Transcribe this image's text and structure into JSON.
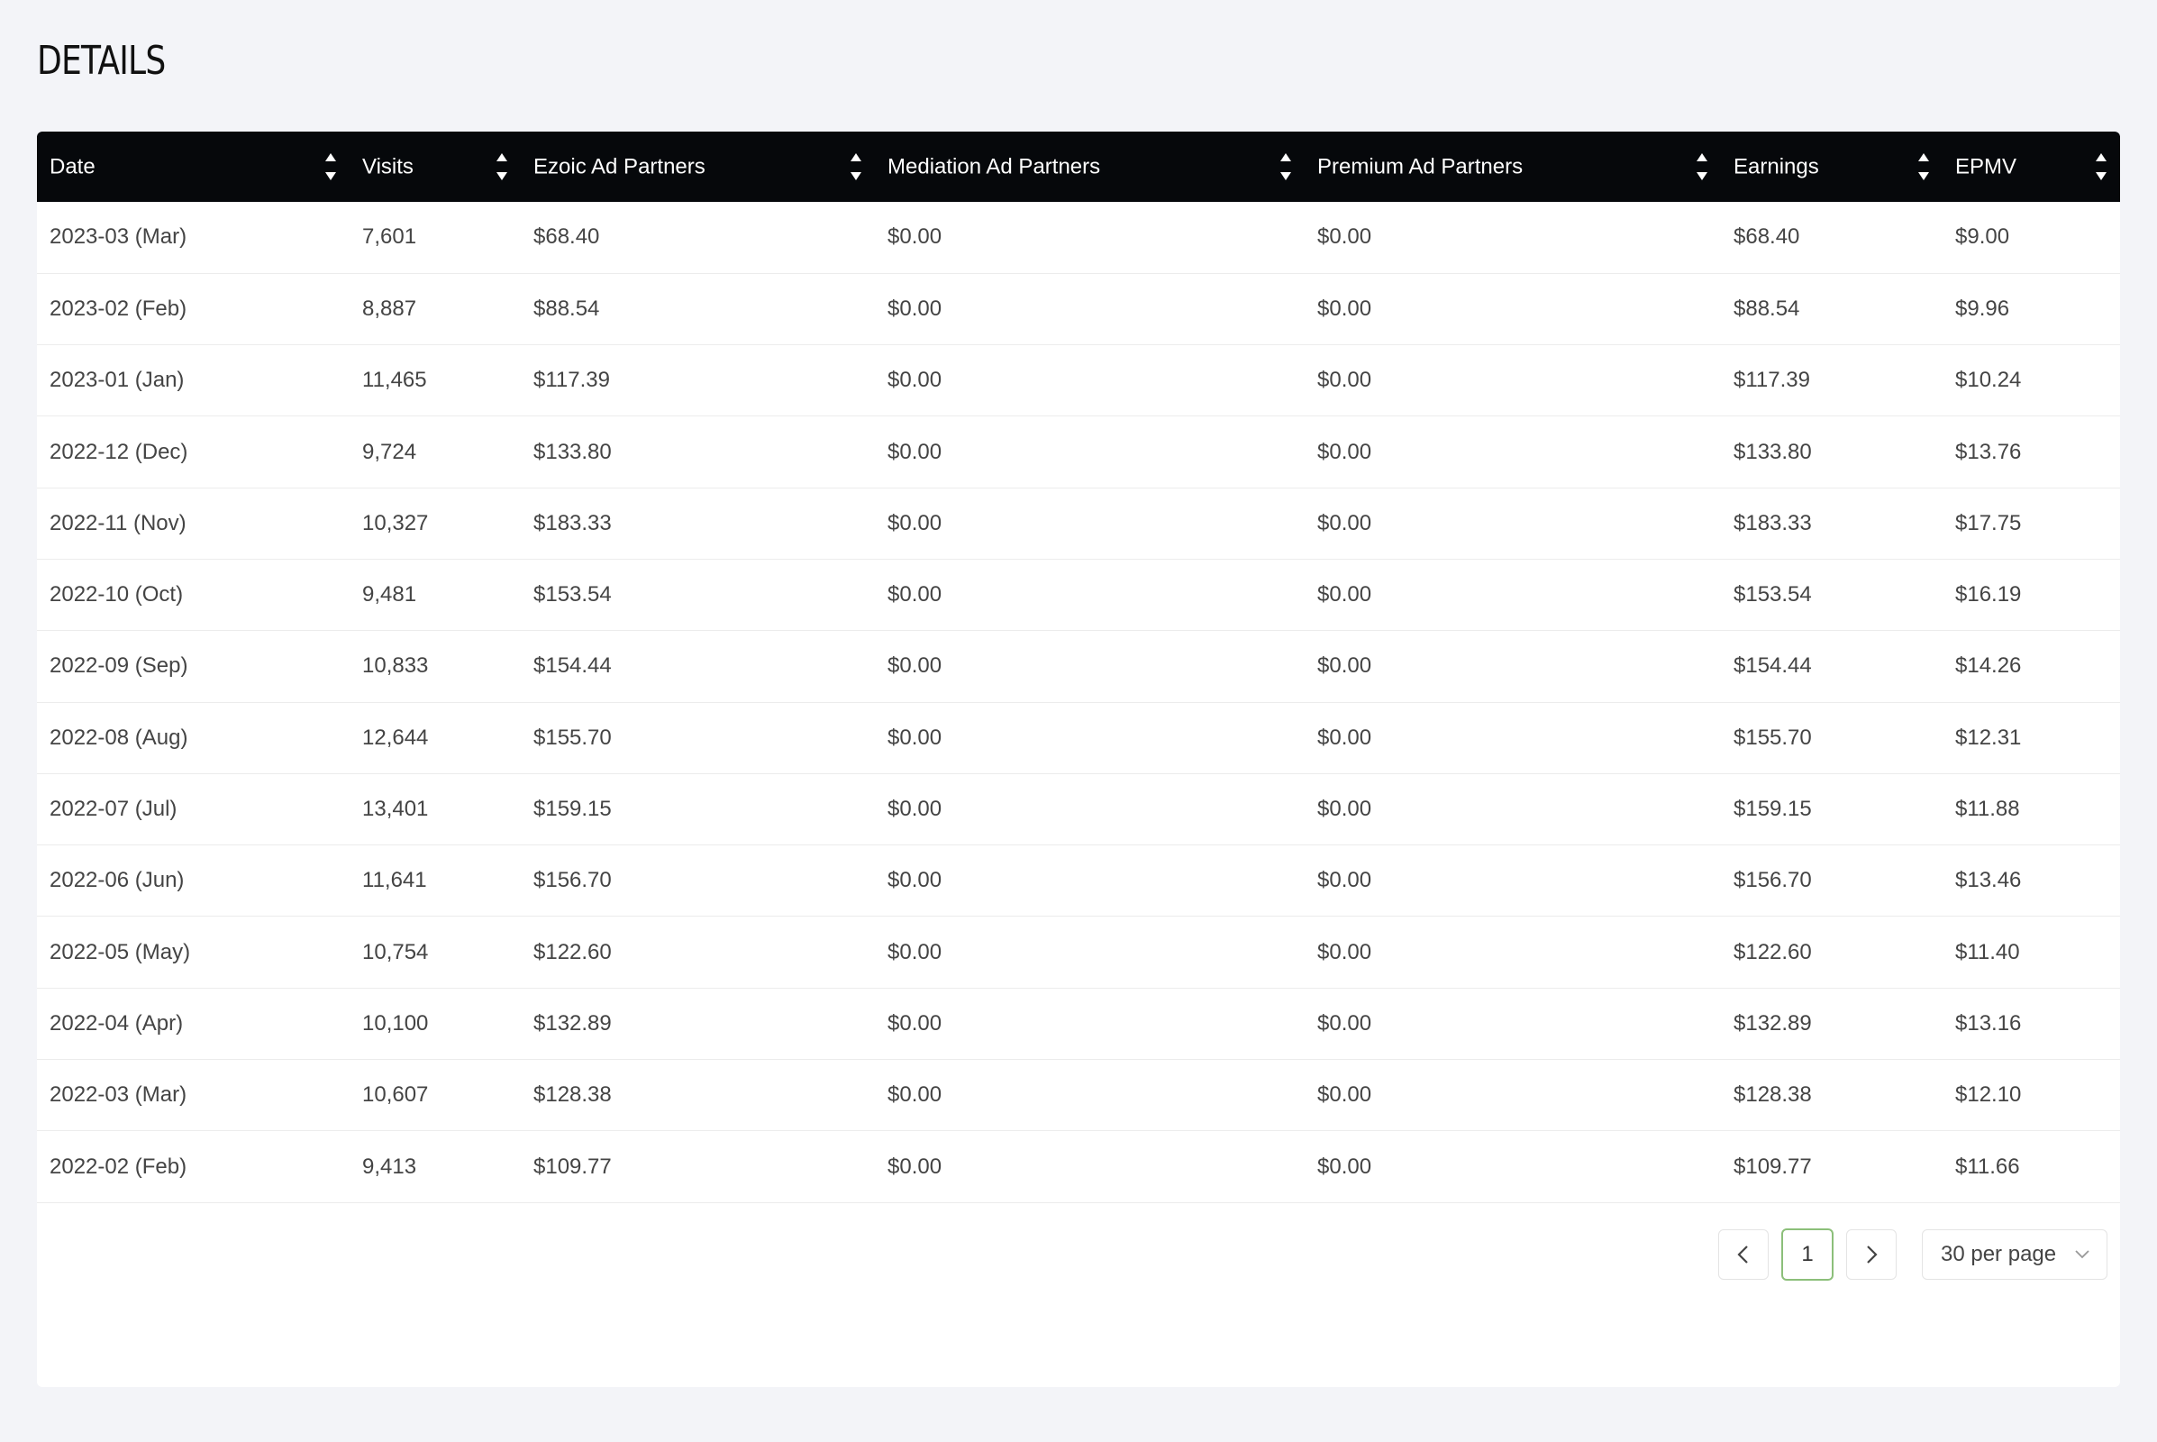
{
  "page": {
    "title": "DETAILS"
  },
  "table": {
    "columns": [
      "Date",
      "Visits",
      "Ezoic Ad Partners",
      "Mediation Ad Partners",
      "Premium Ad Partners",
      "Earnings",
      "EPMV"
    ],
    "rows": [
      [
        "2023-03 (Mar)",
        "7,601",
        "$68.40",
        "$0.00",
        "$0.00",
        "$68.40",
        "$9.00"
      ],
      [
        "2023-02 (Feb)",
        "8,887",
        "$88.54",
        "$0.00",
        "$0.00",
        "$88.54",
        "$9.96"
      ],
      [
        "2023-01 (Jan)",
        "11,465",
        "$117.39",
        "$0.00",
        "$0.00",
        "$117.39",
        "$10.24"
      ],
      [
        "2022-12 (Dec)",
        "9,724",
        "$133.80",
        "$0.00",
        "$0.00",
        "$133.80",
        "$13.76"
      ],
      [
        "2022-11 (Nov)",
        "10,327",
        "$183.33",
        "$0.00",
        "$0.00",
        "$183.33",
        "$17.75"
      ],
      [
        "2022-10 (Oct)",
        "9,481",
        "$153.54",
        "$0.00",
        "$0.00",
        "$153.54",
        "$16.19"
      ],
      [
        "2022-09 (Sep)",
        "10,833",
        "$154.44",
        "$0.00",
        "$0.00",
        "$154.44",
        "$14.26"
      ],
      [
        "2022-08 (Aug)",
        "12,644",
        "$155.70",
        "$0.00",
        "$0.00",
        "$155.70",
        "$12.31"
      ],
      [
        "2022-07 (Jul)",
        "13,401",
        "$159.15",
        "$0.00",
        "$0.00",
        "$159.15",
        "$11.88"
      ],
      [
        "2022-06 (Jun)",
        "11,641",
        "$156.70",
        "$0.00",
        "$0.00",
        "$156.70",
        "$13.46"
      ],
      [
        "2022-05 (May)",
        "10,754",
        "$122.60",
        "$0.00",
        "$0.00",
        "$122.60",
        "$11.40"
      ],
      [
        "2022-04 (Apr)",
        "10,100",
        "$132.89",
        "$0.00",
        "$0.00",
        "$132.89",
        "$13.16"
      ],
      [
        "2022-03 (Mar)",
        "10,607",
        "$128.38",
        "$0.00",
        "$0.00",
        "$128.38",
        "$12.10"
      ],
      [
        "2022-02 (Feb)",
        "9,413",
        "$109.77",
        "$0.00",
        "$0.00",
        "$109.77",
        "$11.66"
      ]
    ]
  },
  "pagination": {
    "prev_icon": "chevron-left-icon",
    "next_icon": "chevron-right-icon",
    "current_page": "1",
    "per_page": "30 per page",
    "per_page_icon": "chevron-down-icon"
  },
  "colors": {
    "header_bg": "#06080b",
    "page_bg": "#f3f4f8",
    "current_page_border": "#8cbf7a"
  }
}
